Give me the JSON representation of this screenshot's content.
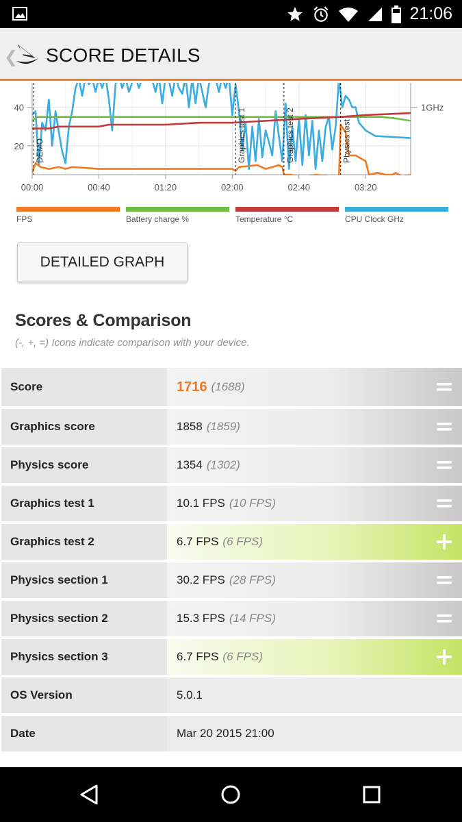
{
  "status_bar": {
    "time": "21:06",
    "icons": [
      "image-notification-icon",
      "star-icon",
      "alarm-icon",
      "wifi-icon",
      "signal-icon",
      "battery-icon"
    ]
  },
  "header": {
    "back_glyph": "❮",
    "title": "SCORE DETAILS",
    "accent_color": "#f07a22"
  },
  "chart_data": {
    "type": "line",
    "x_tick_labels": [
      "00:00",
      "00:40",
      "01:20",
      "02:00",
      "02:40",
      "03:20"
    ],
    "x_tick_seconds": [
      0,
      40,
      80,
      120,
      160,
      200
    ],
    "x_range_seconds": [
      0,
      227
    ],
    "y_tick_labels": [
      "20",
      "40"
    ],
    "y_ticks": [
      20,
      40
    ],
    "y_range_visible": [
      5,
      52
    ],
    "right_axis_label": "1GHz",
    "right_axis_value": 40,
    "phase_markers": [
      {
        "label": "DEMO",
        "t": 0
      },
      {
        "label": "Graphics test 1",
        "t": 122
      },
      {
        "label": "Graphics test 2",
        "t": 151
      },
      {
        "label": "Physics test",
        "t": 185
      }
    ],
    "series": [
      {
        "name": "FPS",
        "color": "#f07a22",
        "points": [
          [
            0,
            6
          ],
          [
            2,
            11
          ],
          [
            5,
            9
          ],
          [
            10,
            8
          ],
          [
            16,
            9
          ],
          [
            20,
            8
          ],
          [
            24,
            9
          ],
          [
            40,
            8
          ],
          [
            80,
            8
          ],
          [
            120,
            8
          ],
          [
            122,
            7
          ],
          [
            124,
            9
          ],
          [
            135,
            10
          ],
          [
            140,
            8
          ],
          [
            148,
            10
          ],
          [
            150,
            9
          ],
          [
            151,
            5
          ],
          [
            155,
            5
          ],
          [
            160,
            4
          ],
          [
            165,
            4
          ],
          [
            170,
            5
          ],
          [
            180,
            4
          ],
          [
            184,
            4
          ],
          [
            185,
            31
          ],
          [
            188,
            27
          ],
          [
            190,
            15
          ],
          [
            194,
            15
          ],
          [
            198,
            13
          ],
          [
            200,
            12
          ],
          [
            202,
            5
          ],
          [
            207,
            6
          ],
          [
            212,
            5
          ],
          [
            216,
            5
          ],
          [
            218,
            6
          ],
          [
            222,
            4
          ],
          [
            227,
            5
          ]
        ]
      },
      {
        "name": "Battery charge %",
        "color": "#6cbf43",
        "points": [
          [
            0,
            33
          ],
          [
            3,
            35
          ],
          [
            40,
            35
          ],
          [
            80,
            35
          ],
          [
            120,
            35
          ],
          [
            150,
            35
          ],
          [
            185,
            35
          ],
          [
            210,
            35
          ],
          [
            220,
            34
          ],
          [
            227,
            33
          ]
        ]
      },
      {
        "name": "Temperature °C",
        "color": "#c33a3a",
        "points": [
          [
            0,
            29
          ],
          [
            10,
            29
          ],
          [
            16,
            30
          ],
          [
            40,
            30
          ],
          [
            46,
            31
          ],
          [
            80,
            31
          ],
          [
            100,
            32
          ],
          [
            120,
            32
          ],
          [
            140,
            33
          ],
          [
            160,
            34
          ],
          [
            185,
            35
          ],
          [
            200,
            36
          ],
          [
            227,
            37
          ]
        ]
      },
      {
        "name": "CPU Clock GHz",
        "color": "#3aace0",
        "points": [
          [
            0,
            36
          ],
          [
            2,
            38
          ],
          [
            4,
            10
          ],
          [
            6,
            32
          ],
          [
            8,
            28
          ],
          [
            10,
            44
          ],
          [
            12,
            20
          ],
          [
            14,
            38
          ],
          [
            16,
            27
          ],
          [
            18,
            17
          ],
          [
            20,
            11
          ],
          [
            22,
            30
          ],
          [
            24,
            38
          ],
          [
            26,
            50
          ],
          [
            28,
            55
          ],
          [
            30,
            46
          ],
          [
            32,
            56
          ],
          [
            34,
            52
          ],
          [
            36,
            55
          ],
          [
            38,
            48
          ],
          [
            40,
            55
          ],
          [
            42,
            50
          ],
          [
            44,
            56
          ],
          [
            46,
            44
          ],
          [
            48,
            28
          ],
          [
            50,
            52
          ],
          [
            52,
            56
          ],
          [
            54,
            50
          ],
          [
            56,
            55
          ],
          [
            58,
            48
          ],
          [
            60,
            53
          ],
          [
            62,
            56
          ],
          [
            64,
            50
          ],
          [
            66,
            55
          ],
          [
            70,
            56
          ],
          [
            72,
            54
          ],
          [
            74,
            48
          ],
          [
            76,
            56
          ],
          [
            78,
            42
          ],
          [
            80,
            56
          ],
          [
            82,
            54
          ],
          [
            84,
            46
          ],
          [
            86,
            56
          ],
          [
            88,
            50
          ],
          [
            90,
            47
          ],
          [
            92,
            56
          ],
          [
            94,
            40
          ],
          [
            96,
            55
          ],
          [
            98,
            42
          ],
          [
            100,
            56
          ],
          [
            102,
            48
          ],
          [
            104,
            40
          ],
          [
            106,
            52
          ],
          [
            108,
            56
          ],
          [
            110,
            55
          ],
          [
            112,
            48
          ],
          [
            114,
            56
          ],
          [
            116,
            50
          ],
          [
            118,
            56
          ],
          [
            120,
            36
          ],
          [
            122,
            52
          ],
          [
            124,
            38
          ],
          [
            126,
            18
          ],
          [
            128,
            32
          ],
          [
            130,
            8
          ],
          [
            132,
            30
          ],
          [
            134,
            12
          ],
          [
            136,
            34
          ],
          [
            138,
            14
          ],
          [
            140,
            28
          ],
          [
            142,
            22
          ],
          [
            144,
            15
          ],
          [
            146,
            38
          ],
          [
            148,
            25
          ],
          [
            150,
            12
          ],
          [
            152,
            42
          ],
          [
            154,
            8
          ],
          [
            156,
            30
          ],
          [
            158,
            12
          ],
          [
            160,
            34
          ],
          [
            162,
            10
          ],
          [
            164,
            36
          ],
          [
            166,
            15
          ],
          [
            168,
            33
          ],
          [
            170,
            8
          ],
          [
            172,
            28
          ],
          [
            174,
            12
          ],
          [
            176,
            30
          ],
          [
            178,
            35
          ],
          [
            180,
            18
          ],
          [
            182,
            30
          ],
          [
            184,
            55
          ],
          [
            186,
            40
          ],
          [
            188,
            46
          ],
          [
            190,
            44
          ],
          [
            192,
            40
          ],
          [
            194,
            40
          ],
          [
            196,
            32
          ],
          [
            198,
            30
          ],
          [
            200,
            28
          ],
          [
            202,
            27
          ],
          [
            204,
            26
          ],
          [
            206,
            25
          ],
          [
            208,
            25
          ],
          [
            227,
            24
          ]
        ]
      }
    ]
  },
  "legend": [
    {
      "label": "FPS",
      "color": "#f07a22"
    },
    {
      "label": "Battery charge %",
      "color": "#6cbf43"
    },
    {
      "label": "Temperature °C",
      "color": "#c33a3a"
    },
    {
      "label": "CPU Clock GHz",
      "color": "#3aace0"
    }
  ],
  "detailed_graph_button": "DETAILED GRAPH",
  "section": {
    "title": "Scores & Comparison",
    "subtitle": "(-, +, =) Icons indicate comparison with your device."
  },
  "results": [
    {
      "label": "Score",
      "value": "1716",
      "reference": "(1688)",
      "comparison": "equal",
      "highlight": true
    },
    {
      "label": "Graphics score",
      "value": "1858",
      "reference": "(1859)",
      "comparison": "equal"
    },
    {
      "label": "Physics score",
      "value": "1354",
      "reference": "(1302)",
      "comparison": "equal"
    },
    {
      "label": "Graphics test 1",
      "value": "10.1 FPS",
      "reference": "(10 FPS)",
      "comparison": "equal"
    },
    {
      "label": "Graphics test 2",
      "value": "6.7 FPS",
      "reference": "(6 FPS)",
      "comparison": "better"
    },
    {
      "label": "Physics section 1",
      "value": "30.2 FPS",
      "reference": "(28 FPS)",
      "comparison": "equal"
    },
    {
      "label": "Physics section 2",
      "value": "15.3 FPS",
      "reference": "(14 FPS)",
      "comparison": "equal"
    },
    {
      "label": "Physics section 3",
      "value": "6.7 FPS",
      "reference": "(6 FPS)",
      "comparison": "better"
    },
    {
      "label": "OS Version",
      "value": "5.0.1",
      "reference": "",
      "comparison": "none"
    },
    {
      "label": "Date",
      "value": "Mar 20 2015 21:00",
      "reference": "",
      "comparison": "none"
    }
  ],
  "nav_bar": {
    "buttons": [
      "back-icon",
      "home-icon",
      "recents-icon"
    ]
  }
}
